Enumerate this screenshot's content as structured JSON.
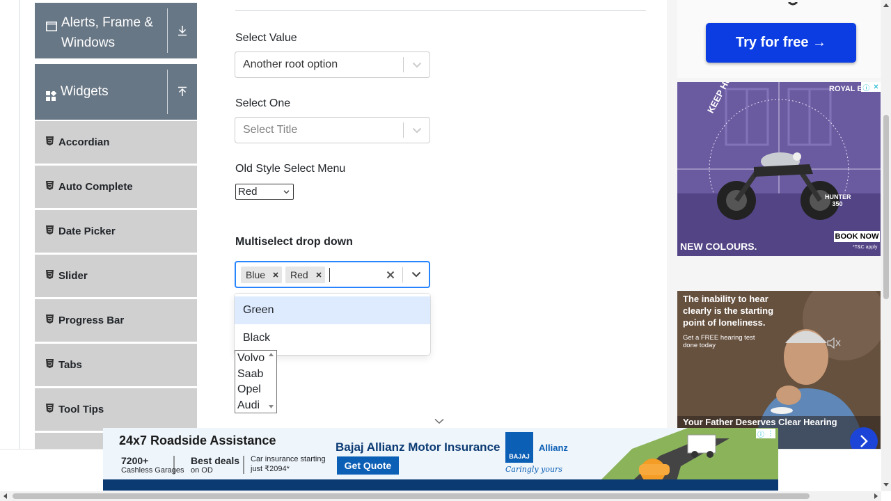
{
  "sidebar": {
    "alerts_group": "Alerts, Frame & Windows",
    "widgets_group": "Widgets",
    "items": [
      "Accordian",
      "Auto Complete",
      "Date Picker",
      "Slider",
      "Progress Bar",
      "Tabs",
      "Tool Tips"
    ]
  },
  "form": {
    "select_value_label": "Select Value",
    "select_value_current": "Another root option",
    "select_one_label": "Select One",
    "select_one_placeholder": "Select Title",
    "old_style_label": "Old Style Select Menu",
    "old_style_value": "Red",
    "multiselect_label": "Multiselect drop down",
    "multiselect_chips": [
      "Blue",
      "Red"
    ],
    "menu_options": [
      "Green",
      "Black"
    ],
    "listbox_options": [
      "Volvo",
      "Saab",
      "Opel",
      "Audi"
    ]
  },
  "ads": {
    "try_button": "Try for free →",
    "moto_brand": "ROYAL EN",
    "moto_tagline": "KEEP HUNTING",
    "moto_model": "HUNTER 350",
    "moto_colours": "NEW COLOURS.",
    "moto_cta": "BOOK NOW",
    "moto_tc": "*T&C apply",
    "hearing_line1": "The inability to hear clearly is the starting point of loneliness.",
    "hearing_line2": "Get a FREE hearing test done today",
    "hearing_footer": "Your Father Deserves Clear Hearing",
    "banner_headline": "24x7 Roadside Assistance",
    "banner_stat1": "7200+",
    "banner_stat1_sub": "Cashless Garages",
    "banner_stat2": "Best deals",
    "banner_stat2_sub": "on OD",
    "banner_stat3": "Car insurance starting just ₹2094*",
    "banner_brand": "Bajaj Allianz Motor Insurance",
    "banner_cta": "Get Quote",
    "banner_logo1": "BAJAJ",
    "banner_logo2": "Allianz",
    "banner_slogan": "Caringly yours"
  },
  "colors": {
    "sidebar_header": "#687785",
    "menu_item": "#d0d0d0",
    "focus_blue": "#2684ff",
    "option_active": "#deebff",
    "try_button": "#0b3de3"
  }
}
